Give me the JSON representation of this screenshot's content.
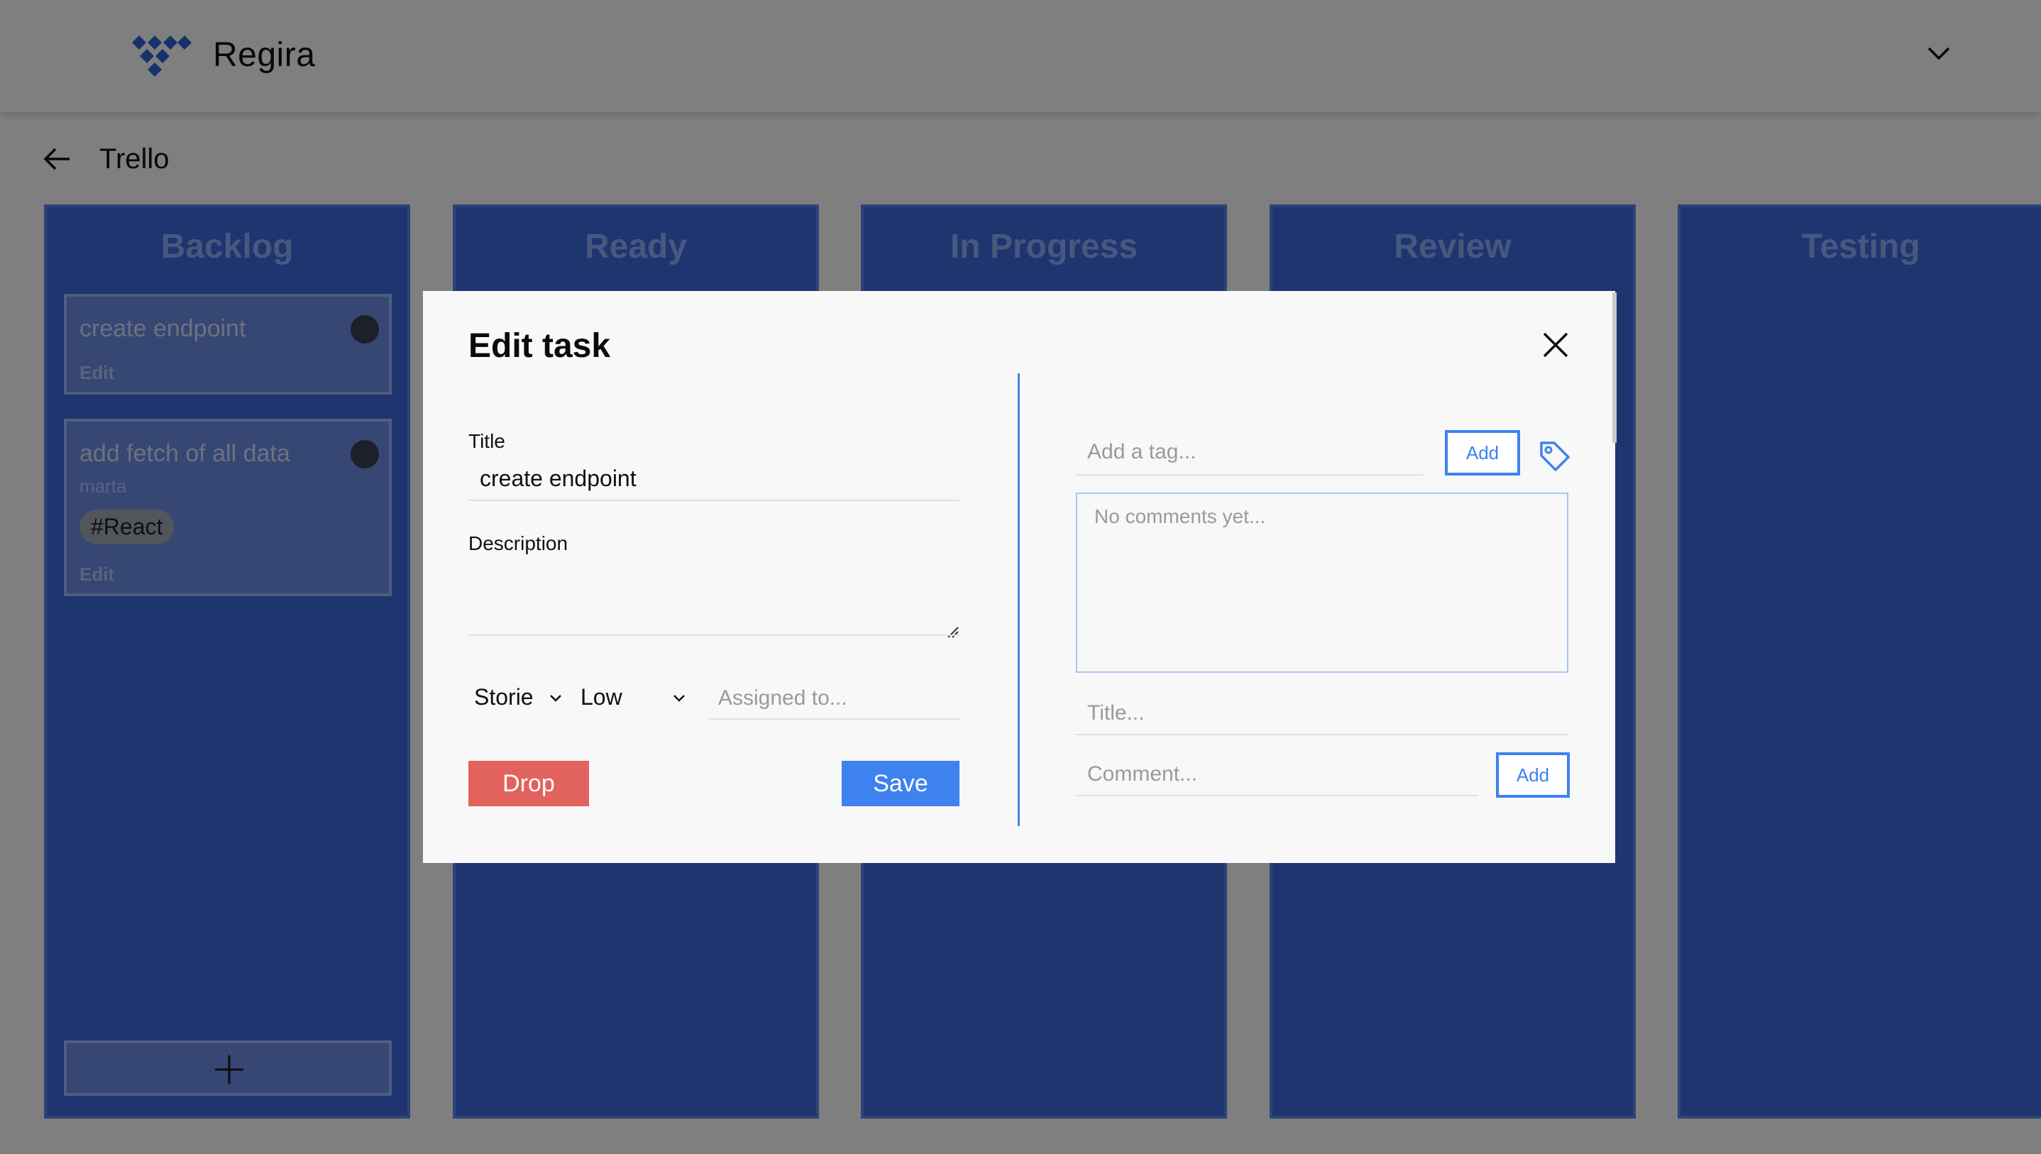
{
  "app": {
    "brand": "Regira",
    "logo_icon": "diamond-logo-icon",
    "user_menu_icon": "chevron-down-icon"
  },
  "board": {
    "back_icon": "arrow-left-icon",
    "title": "Trello"
  },
  "columns": [
    {
      "title": "Backlog"
    },
    {
      "title": "Ready"
    },
    {
      "title": "In Progress"
    },
    {
      "title": "Review"
    },
    {
      "title": "Testing"
    }
  ],
  "backlog_cards": [
    {
      "title": "create endpoint",
      "edit_label": "Edit"
    },
    {
      "title": "add fetch of all data",
      "assignee": "marta",
      "tag": "#React",
      "edit_label": "Edit"
    }
  ],
  "add_card_icon": "plus-icon",
  "modal": {
    "title": "Edit task",
    "close_icon": "close-icon",
    "title_label": "Title",
    "title_value": "create endpoint",
    "description_label": "Description",
    "description_value": "",
    "type_value": "Storie",
    "priority_value": "Low",
    "assigned_placeholder": "Assigned to...",
    "drop_label": "Drop",
    "save_label": "Save",
    "tag_placeholder": "Add a tag...",
    "tag_add_label": "Add",
    "tag_icon": "tag-icon",
    "comments_placeholder": "No comments yet...",
    "comment_title_placeholder": "Title...",
    "comment_placeholder": "Comment...",
    "comment_add_label": "Add"
  },
  "colors": {
    "column_bg": "#3d6be0",
    "accent_blue": "#3d82ef",
    "drop_red": "#e2625e",
    "overlay": "rgba(0,0,0,0.5)"
  }
}
